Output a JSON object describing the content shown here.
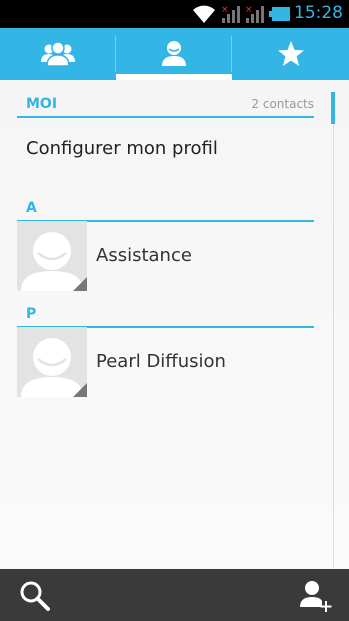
{
  "status_bar": {
    "time": "15:28",
    "icons": [
      "wifi-icon",
      "signal-no-service-icon",
      "signal-no-service-icon",
      "battery-icon"
    ]
  },
  "tabs": [
    {
      "name": "groups",
      "icon": "groups-icon",
      "selected": false
    },
    {
      "name": "contacts",
      "icon": "person-icon",
      "selected": true
    },
    {
      "name": "favorites",
      "icon": "star-icon",
      "selected": false
    }
  ],
  "me_section": {
    "title": "MOI",
    "count": "2 contacts",
    "profile_label": "Configurer mon profil"
  },
  "sections": [
    {
      "letter": "A",
      "contacts": [
        {
          "name": "Assistance"
        }
      ]
    },
    {
      "letter": "P",
      "contacts": [
        {
          "name": "Pearl Diffusion"
        }
      ]
    }
  ],
  "bottom_bar": {
    "actions": [
      "search-icon",
      "add-contact-icon"
    ]
  },
  "colors": {
    "accent": "#33b5e5",
    "status_bar": "#000000",
    "bottom_bar": "#3a3a3a"
  }
}
